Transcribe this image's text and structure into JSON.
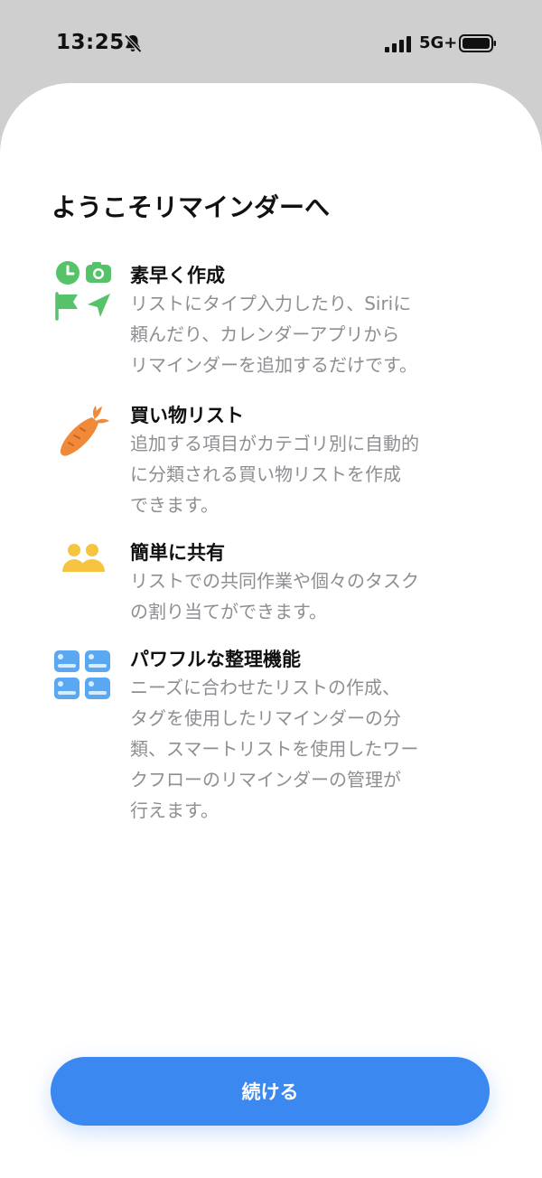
{
  "status_bar": {
    "time": "13:25",
    "network": "5G+",
    "icons": [
      "bell-slash-icon",
      "cellular-signal-icon",
      "battery-icon"
    ]
  },
  "colors": {
    "accent": "#3a88f0",
    "green": "#56c26a",
    "orange": "#f08a3a",
    "yellow": "#f5c542",
    "blue": "#5aa8f2",
    "secondary_text": "#8e8e93"
  },
  "welcome": {
    "title": "ようこそリマインダーへ"
  },
  "features": [
    {
      "icon": "reminder-tools-icon",
      "title": "素早く作成",
      "description": "リストにタイプ入力したり、Siriに\n頼んだり、カレンダーアプリから\nリマインダーを追加するだけです。"
    },
    {
      "icon": "carrot-icon",
      "title": "買い物リスト",
      "description": "追加する項目がカテゴリ別に自動的\nに分類される買い物リストを作成\nできます。"
    },
    {
      "icon": "people-icon",
      "title": "簡単に共有",
      "description": "リストでの共同作業や個々のタスク\nの割り当てができます。"
    },
    {
      "icon": "lists-grid-icon",
      "title": "パワフルな整理機能",
      "description": "ニーズに合わせたリストの作成、\nタグを使用したリマインダーの分\n類、スマートリストを使用したワー\nクフローのリマインダーの管理が\n行えます。"
    }
  ],
  "button": {
    "continue_label": "続ける"
  }
}
